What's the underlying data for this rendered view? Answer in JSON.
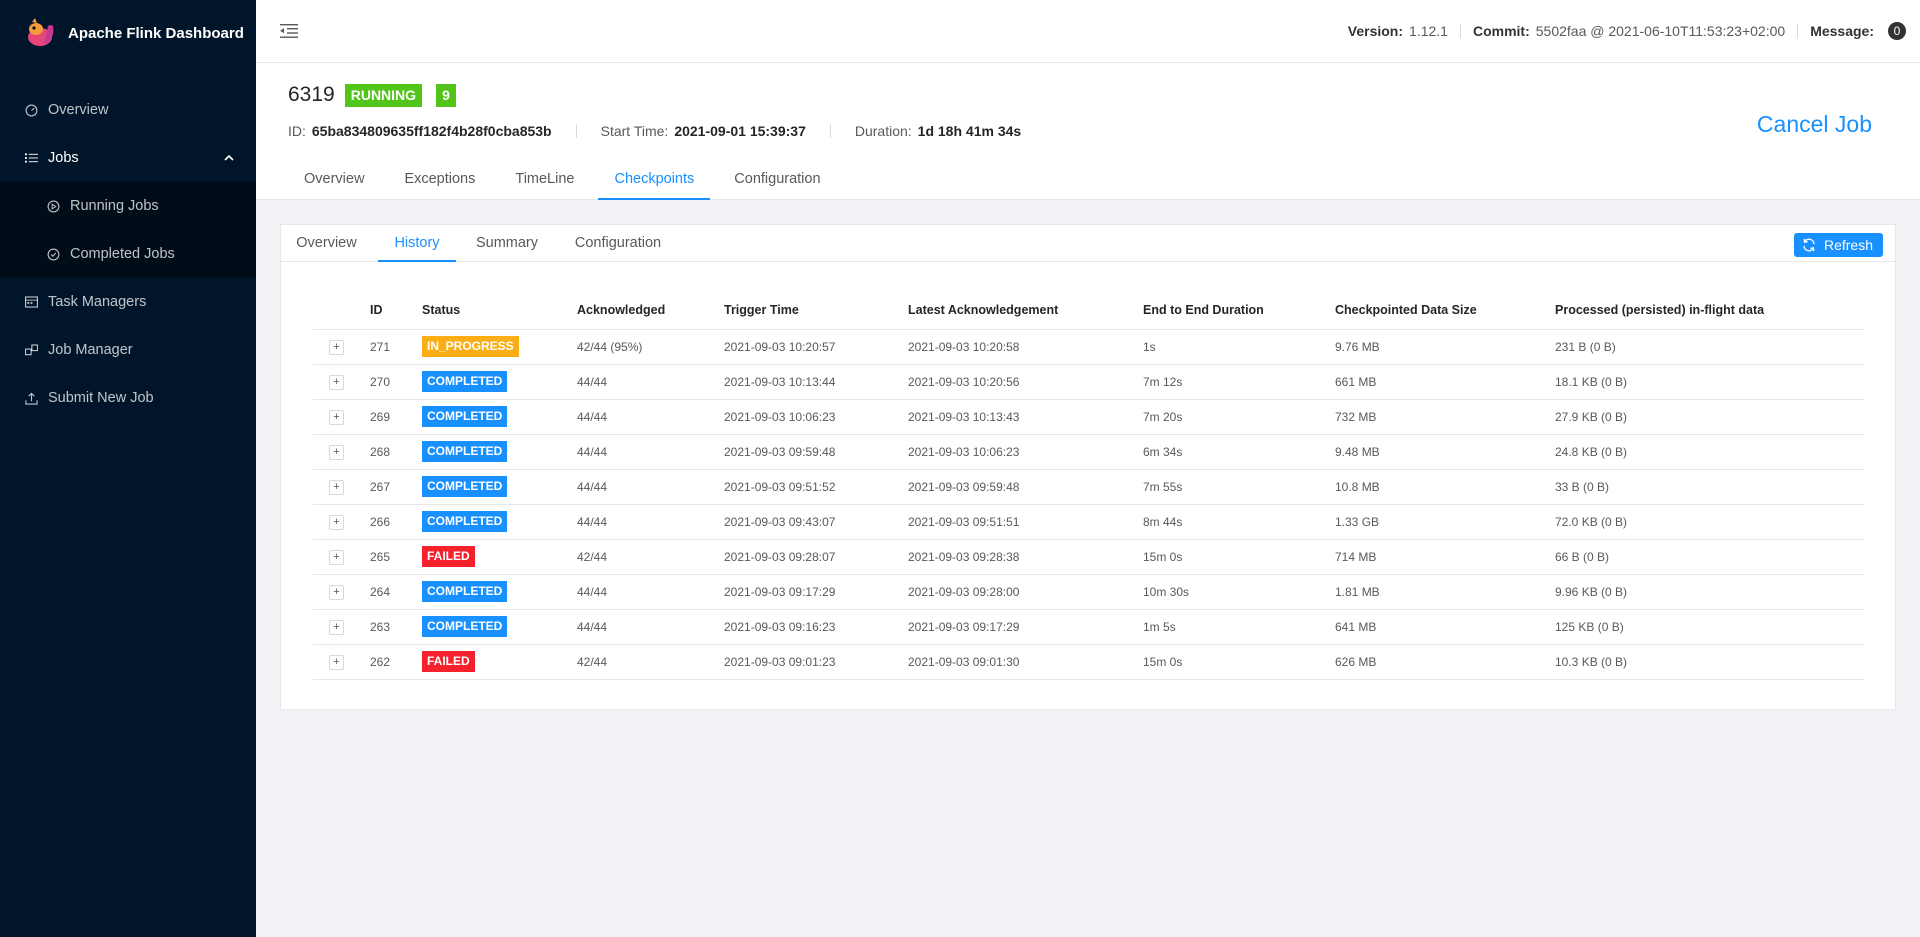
{
  "app": {
    "title": "Apache Flink Dashboard"
  },
  "sidebar": {
    "items": [
      {
        "label": "Overview",
        "icon": "dashboard-icon"
      },
      {
        "label": "Jobs",
        "icon": "list-icon"
      },
      {
        "label": "Running Jobs",
        "icon": "play-circle-icon"
      },
      {
        "label": "Completed Jobs",
        "icon": "check-circle-icon"
      },
      {
        "label": "Task Managers",
        "icon": "server-icon"
      },
      {
        "label": "Job Manager",
        "icon": "cluster-icon"
      },
      {
        "label": "Submit New Job",
        "icon": "upload-icon"
      }
    ]
  },
  "header": {
    "version_label": "Version:",
    "version": "1.12.1",
    "commit_label": "Commit:",
    "commit": "5502faa @ 2021-06-10T11:53:23+02:00",
    "message_label": "Message:",
    "message_count": "0"
  },
  "job": {
    "name": "6319",
    "status": "RUNNING",
    "parallelism": "9",
    "id_label": "ID:",
    "id": "65ba834809635ff182f4b28f0cba853b",
    "start_label": "Start Time:",
    "start_time": "2021-09-01 15:39:37",
    "duration_label": "Duration:",
    "duration": "1d 18h 41m 34s",
    "cancel_label": "Cancel Job"
  },
  "main_tabs": [
    "Overview",
    "Exceptions",
    "TimeLine",
    "Checkpoints",
    "Configuration"
  ],
  "sub_tabs": [
    "Overview",
    "History",
    "Summary",
    "Configuration"
  ],
  "refresh_label": "Refresh",
  "table": {
    "columns": [
      "ID",
      "Status",
      "Acknowledged",
      "Trigger Time",
      "Latest Acknowledgement",
      "End to End Duration",
      "Checkpointed Data Size",
      "Processed (persisted) in-flight data"
    ],
    "rows": [
      {
        "id": "271",
        "status": "IN_PROGRESS",
        "ack": "42/44 (95%)",
        "trigger": "2021-09-03 10:20:57",
        "latest": "2021-09-03 10:20:58",
        "duration": "1s",
        "size": "9.76 MB",
        "inflight": "231 B (0 B)"
      },
      {
        "id": "270",
        "status": "COMPLETED",
        "ack": "44/44",
        "trigger": "2021-09-03 10:13:44",
        "latest": "2021-09-03 10:20:56",
        "duration": "7m 12s",
        "size": "661 MB",
        "inflight": "18.1 KB (0 B)"
      },
      {
        "id": "269",
        "status": "COMPLETED",
        "ack": "44/44",
        "trigger": "2021-09-03 10:06:23",
        "latest": "2021-09-03 10:13:43",
        "duration": "7m 20s",
        "size": "732 MB",
        "inflight": "27.9 KB (0 B)"
      },
      {
        "id": "268",
        "status": "COMPLETED",
        "ack": "44/44",
        "trigger": "2021-09-03 09:59:48",
        "latest": "2021-09-03 10:06:23",
        "duration": "6m 34s",
        "size": "9.48 MB",
        "inflight": "24.8 KB (0 B)"
      },
      {
        "id": "267",
        "status": "COMPLETED",
        "ack": "44/44",
        "trigger": "2021-09-03 09:51:52",
        "latest": "2021-09-03 09:59:48",
        "duration": "7m 55s",
        "size": "10.8 MB",
        "inflight": "33 B (0 B)"
      },
      {
        "id": "266",
        "status": "COMPLETED",
        "ack": "44/44",
        "trigger": "2021-09-03 09:43:07",
        "latest": "2021-09-03 09:51:51",
        "duration": "8m 44s",
        "size": "1.33 GB",
        "inflight": "72.0 KB (0 B)"
      },
      {
        "id": "265",
        "status": "FAILED",
        "ack": "42/44",
        "trigger": "2021-09-03 09:28:07",
        "latest": "2021-09-03 09:28:38",
        "duration": "15m 0s",
        "size": "714 MB",
        "inflight": "66 B (0 B)"
      },
      {
        "id": "264",
        "status": "COMPLETED",
        "ack": "44/44",
        "trigger": "2021-09-03 09:17:29",
        "latest": "2021-09-03 09:28:00",
        "duration": "10m 30s",
        "size": "1.81 MB",
        "inflight": "9.96 KB (0 B)"
      },
      {
        "id": "263",
        "status": "COMPLETED",
        "ack": "44/44",
        "trigger": "2021-09-03 09:16:23",
        "latest": "2021-09-03 09:17:29",
        "duration": "1m 5s",
        "size": "641 MB",
        "inflight": "125 KB (0 B)"
      },
      {
        "id": "262",
        "status": "FAILED",
        "ack": "42/44",
        "trigger": "2021-09-03 09:01:23",
        "latest": "2021-09-03 09:01:30",
        "duration": "15m 0s",
        "size": "626 MB",
        "inflight": "10.3 KB (0 B)"
      }
    ]
  },
  "colors": {
    "sidebar_bg": "#001529",
    "accent": "#1890ff",
    "running": "#52c41a",
    "in_progress": "#faad14",
    "failed": "#f5222d"
  }
}
